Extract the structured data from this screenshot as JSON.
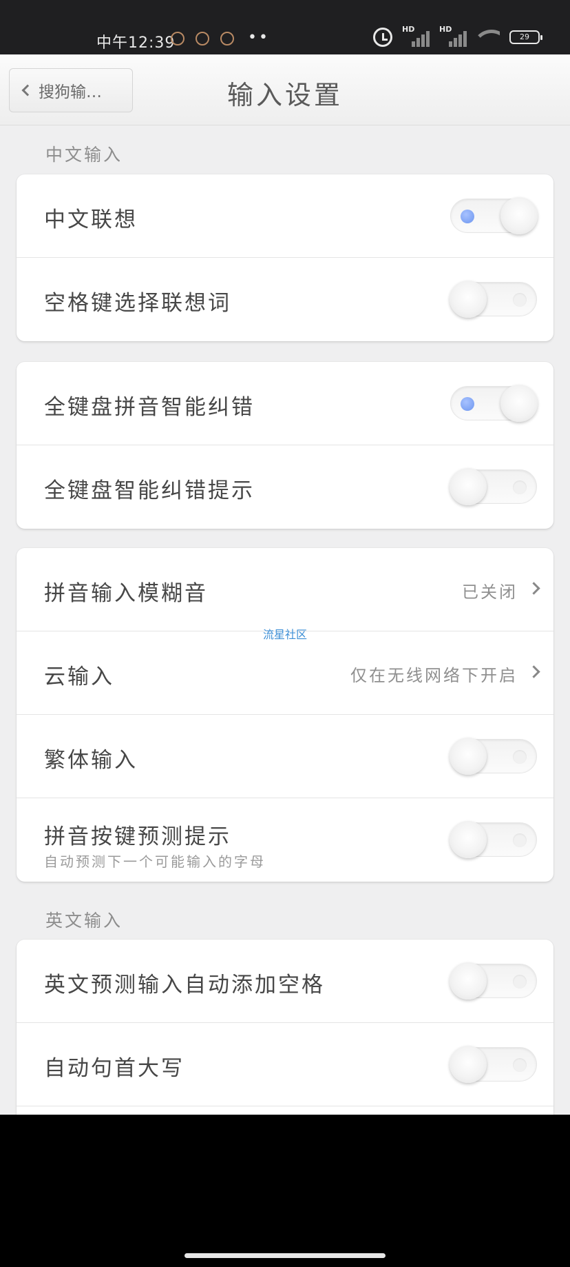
{
  "status_bar": {
    "time": "中午12:39",
    "dots": "••",
    "signal1_label": "HD",
    "signal2_label": "HD",
    "battery": "29"
  },
  "nav": {
    "back_label": "搜狗输…",
    "title": "输入设置"
  },
  "sections": {
    "chinese_title": "中文输入",
    "english_title": "英文输入"
  },
  "rows": {
    "chinese_association": {
      "label": "中文联想",
      "on": true
    },
    "space_select_association": {
      "label": "空格键选择联想词",
      "on": false
    },
    "full_keyboard_pinyin_correction": {
      "label": "全键盘拼音智能纠错",
      "on": true
    },
    "full_keyboard_correction_hint": {
      "label": "全键盘智能纠错提示",
      "on": false
    },
    "pinyin_fuzzy": {
      "label": "拼音输入模糊音",
      "value": "已关闭"
    },
    "cloud_input": {
      "label": "云输入",
      "value": "仅在无线网络下开启"
    },
    "traditional_input": {
      "label": "繁体输入",
      "on": false
    },
    "pinyin_key_prediction": {
      "label": "拼音按键预测提示",
      "sub": "自动预测下一个可能输入的字母",
      "on": false
    },
    "english_auto_space": {
      "label": "英文预测输入自动添加空格",
      "on": false
    },
    "auto_capitalize": {
      "label": "自动句首大写",
      "on": false
    }
  },
  "watermark": "流星社区",
  "colors": {
    "toggle_on_dot": "#6e96ef",
    "status_bar_bg": "#1f1f21",
    "page_bg": "#efeff0"
  }
}
